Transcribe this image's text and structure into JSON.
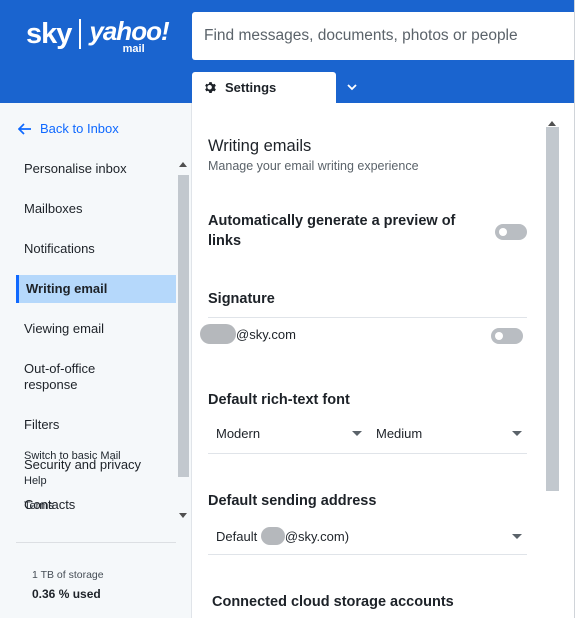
{
  "header": {
    "logo_sky": "sky",
    "logo_yahoo": "yahoo!",
    "logo_mail": "mail",
    "search_placeholder": "Find messages, documents, photos or people"
  },
  "tabs": {
    "settings_label": "Settings",
    "settings_icon": "gear-icon",
    "dropdown_icon": "chevron-down-icon"
  },
  "sidebar": {
    "back_label": "Back to Inbox",
    "items": [
      {
        "label": "Personalise inbox",
        "active": false
      },
      {
        "label": "Mailboxes",
        "active": false
      },
      {
        "label": "Notifications",
        "active": false
      },
      {
        "label": "Writing email",
        "active": true
      },
      {
        "label": "Viewing email",
        "active": false
      },
      {
        "label": "Out-of-office response",
        "active": false
      },
      {
        "label": "Filters",
        "active": false
      },
      {
        "label": "Security and privacy",
        "active": false
      },
      {
        "label": "Contacts",
        "active": false
      }
    ],
    "small_links": [
      "Switch to basic Mail",
      "Help",
      "Terms"
    ],
    "storage_label": "1 TB of storage",
    "storage_used": "0.36 % used"
  },
  "main": {
    "title": "Writing emails",
    "subtitle": "Manage your email writing experience",
    "preview_links": {
      "title": "Automatically generate a preview of links",
      "enabled": false
    },
    "signature": {
      "title": "Signature",
      "email_suffix": "@sky.com",
      "enabled": false
    },
    "font": {
      "title": "Default rich-text font",
      "family": "Modern",
      "size": "Medium"
    },
    "sending": {
      "title": "Default sending address",
      "prefix": "Default ",
      "suffix": "@sky.com)"
    },
    "cloud": {
      "title": "Connected cloud storage accounts"
    }
  },
  "colors": {
    "brand_blue": "#1a64cf",
    "accent_blue": "#0f69ff",
    "active_bg": "#b5d8fb"
  }
}
